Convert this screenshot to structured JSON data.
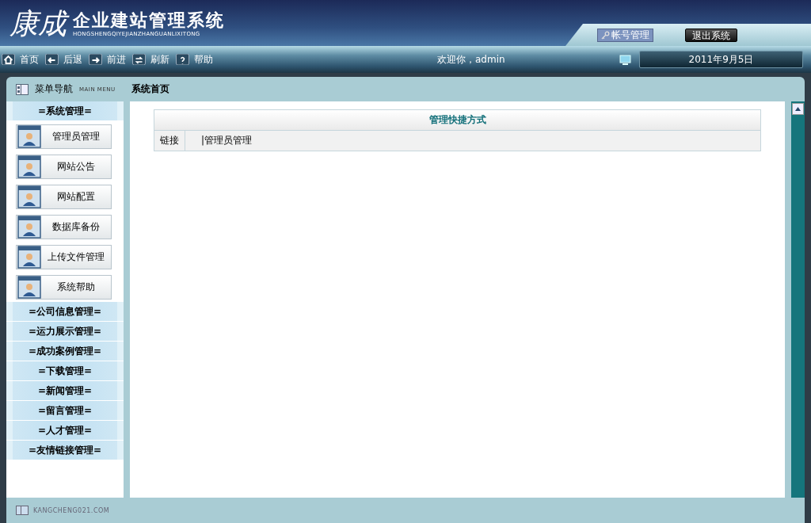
{
  "header": {
    "logo_mark": "康成",
    "title": "企业建站管理系统",
    "subtitle": "HONGSHENGQIYEJIANZHANGUANLIXITONG",
    "account_button": "帐号管理",
    "logout_button": "退出系统"
  },
  "toolbar": {
    "items": [
      {
        "kind": "home",
        "label": "首页"
      },
      {
        "kind": "back",
        "label": "后退"
      },
      {
        "kind": "forward",
        "label": "前进"
      },
      {
        "kind": "refresh",
        "label": "刷新"
      },
      {
        "kind": "help",
        "label": "帮助"
      }
    ],
    "welcome": "欢迎你，admin",
    "date": "2011年9月5日"
  },
  "sidebar": {
    "title": "菜单导航",
    "subtitle": "MAIN MENU",
    "groups": [
      {
        "label": "=系统管理=",
        "items": [
          "管理员管理",
          "网站公告",
          "网站配置",
          "数据库备份",
          "上传文件管理",
          "系统帮助"
        ]
      },
      {
        "label": "=公司信息管理="
      },
      {
        "label": "=运力展示管理="
      },
      {
        "label": "=成功案例管理="
      },
      {
        "label": "=下载管理="
      },
      {
        "label": "=新闻管理="
      },
      {
        "label": "=留言管理="
      },
      {
        "label": "=人才管理="
      },
      {
        "label": "=友情链接管理="
      }
    ]
  },
  "content": {
    "breadcrumb": "系统首页",
    "table_title": "管理快捷方式",
    "row_label": "链接",
    "links": [
      "|管理员管理"
    ]
  },
  "footer": {
    "site": "KANGCHENG021.COM"
  }
}
